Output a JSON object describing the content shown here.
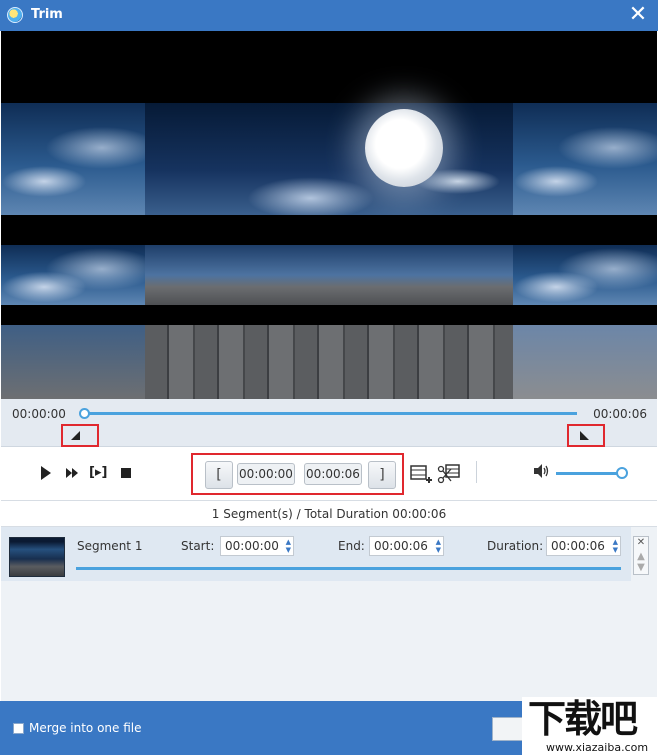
{
  "window": {
    "title": "Trim"
  },
  "timeline": {
    "start_time": "00:00:00",
    "end_time": "00:00:06",
    "position_fraction": 0.0
  },
  "trim": {
    "start_time": "00:00:00",
    "end_time": "00:00:06"
  },
  "volume": {
    "level_fraction": 1.0
  },
  "summary": {
    "text": "1 Segment(s) / Total Duration 00:00:06"
  },
  "segments": [
    {
      "label": "Segment 1",
      "start_label": "Start:",
      "start_value": "00:00:00",
      "end_label": "End:",
      "end_value": "00:00:06",
      "duration_label": "Duration:",
      "duration_value": "00:00:06"
    }
  ],
  "footer": {
    "merge_label": "Merge into one file",
    "merge_checked": false
  },
  "watermark": {
    "big": "下载吧",
    "small": "www.xiazaiba.com"
  },
  "colors": {
    "accent": "#3a78c4",
    "track": "#4aa2de",
    "highlight": "#e0282e"
  },
  "icons": [
    "app-icon",
    "close-icon",
    "play-icon",
    "fast-forward-icon",
    "step-icon",
    "stop-icon",
    "set-start-icon",
    "set-end-icon",
    "add-segment-icon",
    "split-icon",
    "volume-icon",
    "remove-segment-icon"
  ]
}
